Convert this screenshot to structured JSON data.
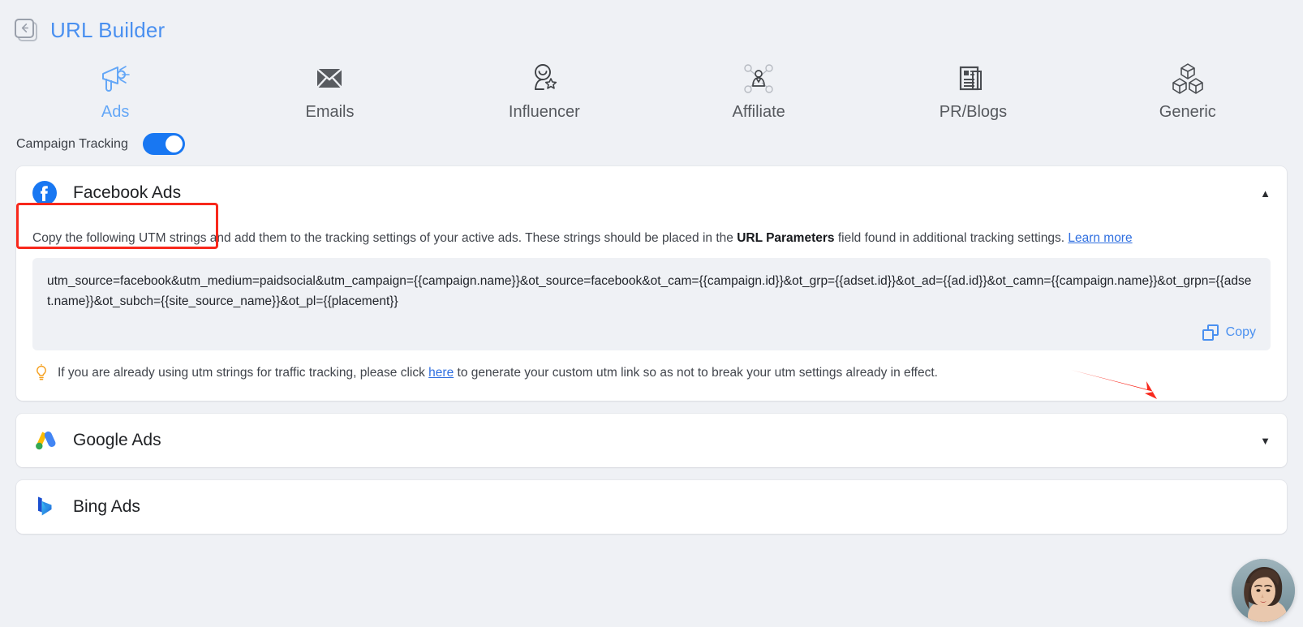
{
  "header": {
    "back_icon": "back-arrow-icon",
    "title": "URL Builder"
  },
  "tabs": [
    {
      "label": "Ads",
      "icon": "megaphone-icon",
      "active": true
    },
    {
      "label": "Emails",
      "icon": "envelope-icon",
      "active": false
    },
    {
      "label": "Influencer",
      "icon": "influencer-icon",
      "active": false
    },
    {
      "label": "Affiliate",
      "icon": "affiliate-network-icon",
      "active": false
    },
    {
      "label": "PR/Blogs",
      "icon": "newspaper-icon",
      "active": false
    },
    {
      "label": "Generic",
      "icon": "cubes-icon",
      "active": false
    }
  ],
  "campaign_tracking": {
    "label": "Campaign Tracking",
    "enabled": true
  },
  "accordions": [
    {
      "name": "Facebook Ads",
      "icon": "facebook-icon",
      "expanded": true,
      "chevron": "▲",
      "highlighted": true
    },
    {
      "name": "Google Ads",
      "icon": "google-ads-icon",
      "expanded": false,
      "chevron": "▼",
      "highlighted": false
    },
    {
      "name": "Bing Ads",
      "icon": "bing-icon",
      "expanded": false,
      "chevron": "▼",
      "highlighted": false
    }
  ],
  "facebook_panel": {
    "desc_part1": "Copy the following UTM strings and add them to the tracking settings of your active ads. These strings should be placed in the ",
    "desc_bold": "URL Parameters",
    "desc_part2": " field found in additional tracking settings. ",
    "desc_link": "Learn more",
    "utm_string": "utm_source=facebook&utm_medium=paidsocial&utm_campaign={{campaign.name}}&ot_source=facebook&ot_cam={{campaign.id}}&ot_grp={{adset.id}}&ot_ad={{ad.id}}&ot_camn={{campaign.name}}&ot_grpn={{adset.name}}&ot_subch={{site_source_name}}&ot_pl={{placement}}",
    "copy_label": "Copy",
    "copy_icon": "copy-icon",
    "hint_icon": "lightbulb-icon",
    "hint_part1": "If you are already using utm strings for traffic tracking, please click ",
    "hint_link": "here",
    "hint_part2": " to generate your custom utm link so as not to break your utm settings already in effect."
  },
  "annotations": {
    "arrow": "red-arrow-pointing-to-copy",
    "arrow_color": "#f8281c",
    "highlight_color": "#f8281c"
  },
  "chat_widget": {
    "name": "avatar-chat-launcher"
  },
  "colors": {
    "accent_blue": "#4a90f0",
    "toggle_on": "#1877f2",
    "page_bg": "#eff1f5",
    "card_bg": "#ffffff",
    "link": "#2f6fe0"
  }
}
